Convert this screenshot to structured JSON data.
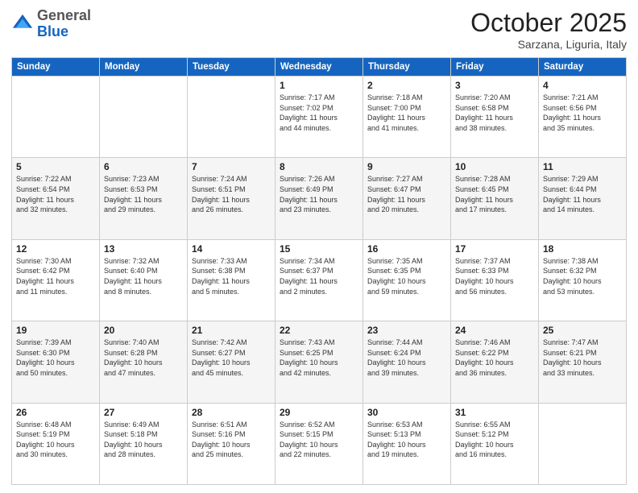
{
  "header": {
    "logo_general": "General",
    "logo_blue": "Blue",
    "month": "October 2025",
    "location": "Sarzana, Liguria, Italy"
  },
  "days_of_week": [
    "Sunday",
    "Monday",
    "Tuesday",
    "Wednesday",
    "Thursday",
    "Friday",
    "Saturday"
  ],
  "weeks": [
    [
      {
        "day": "",
        "info": ""
      },
      {
        "day": "",
        "info": ""
      },
      {
        "day": "",
        "info": ""
      },
      {
        "day": "1",
        "info": "Sunrise: 7:17 AM\nSunset: 7:02 PM\nDaylight: 11 hours\nand 44 minutes."
      },
      {
        "day": "2",
        "info": "Sunrise: 7:18 AM\nSunset: 7:00 PM\nDaylight: 11 hours\nand 41 minutes."
      },
      {
        "day": "3",
        "info": "Sunrise: 7:20 AM\nSunset: 6:58 PM\nDaylight: 11 hours\nand 38 minutes."
      },
      {
        "day": "4",
        "info": "Sunrise: 7:21 AM\nSunset: 6:56 PM\nDaylight: 11 hours\nand 35 minutes."
      }
    ],
    [
      {
        "day": "5",
        "info": "Sunrise: 7:22 AM\nSunset: 6:54 PM\nDaylight: 11 hours\nand 32 minutes."
      },
      {
        "day": "6",
        "info": "Sunrise: 7:23 AM\nSunset: 6:53 PM\nDaylight: 11 hours\nand 29 minutes."
      },
      {
        "day": "7",
        "info": "Sunrise: 7:24 AM\nSunset: 6:51 PM\nDaylight: 11 hours\nand 26 minutes."
      },
      {
        "day": "8",
        "info": "Sunrise: 7:26 AM\nSunset: 6:49 PM\nDaylight: 11 hours\nand 23 minutes."
      },
      {
        "day": "9",
        "info": "Sunrise: 7:27 AM\nSunset: 6:47 PM\nDaylight: 11 hours\nand 20 minutes."
      },
      {
        "day": "10",
        "info": "Sunrise: 7:28 AM\nSunset: 6:45 PM\nDaylight: 11 hours\nand 17 minutes."
      },
      {
        "day": "11",
        "info": "Sunrise: 7:29 AM\nSunset: 6:44 PM\nDaylight: 11 hours\nand 14 minutes."
      }
    ],
    [
      {
        "day": "12",
        "info": "Sunrise: 7:30 AM\nSunset: 6:42 PM\nDaylight: 11 hours\nand 11 minutes."
      },
      {
        "day": "13",
        "info": "Sunrise: 7:32 AM\nSunset: 6:40 PM\nDaylight: 11 hours\nand 8 minutes."
      },
      {
        "day": "14",
        "info": "Sunrise: 7:33 AM\nSunset: 6:38 PM\nDaylight: 11 hours\nand 5 minutes."
      },
      {
        "day": "15",
        "info": "Sunrise: 7:34 AM\nSunset: 6:37 PM\nDaylight: 11 hours\nand 2 minutes."
      },
      {
        "day": "16",
        "info": "Sunrise: 7:35 AM\nSunset: 6:35 PM\nDaylight: 10 hours\nand 59 minutes."
      },
      {
        "day": "17",
        "info": "Sunrise: 7:37 AM\nSunset: 6:33 PM\nDaylight: 10 hours\nand 56 minutes."
      },
      {
        "day": "18",
        "info": "Sunrise: 7:38 AM\nSunset: 6:32 PM\nDaylight: 10 hours\nand 53 minutes."
      }
    ],
    [
      {
        "day": "19",
        "info": "Sunrise: 7:39 AM\nSunset: 6:30 PM\nDaylight: 10 hours\nand 50 minutes."
      },
      {
        "day": "20",
        "info": "Sunrise: 7:40 AM\nSunset: 6:28 PM\nDaylight: 10 hours\nand 47 minutes."
      },
      {
        "day": "21",
        "info": "Sunrise: 7:42 AM\nSunset: 6:27 PM\nDaylight: 10 hours\nand 45 minutes."
      },
      {
        "day": "22",
        "info": "Sunrise: 7:43 AM\nSunset: 6:25 PM\nDaylight: 10 hours\nand 42 minutes."
      },
      {
        "day": "23",
        "info": "Sunrise: 7:44 AM\nSunset: 6:24 PM\nDaylight: 10 hours\nand 39 minutes."
      },
      {
        "day": "24",
        "info": "Sunrise: 7:46 AM\nSunset: 6:22 PM\nDaylight: 10 hours\nand 36 minutes."
      },
      {
        "day": "25",
        "info": "Sunrise: 7:47 AM\nSunset: 6:21 PM\nDaylight: 10 hours\nand 33 minutes."
      }
    ],
    [
      {
        "day": "26",
        "info": "Sunrise: 6:48 AM\nSunset: 5:19 PM\nDaylight: 10 hours\nand 30 minutes."
      },
      {
        "day": "27",
        "info": "Sunrise: 6:49 AM\nSunset: 5:18 PM\nDaylight: 10 hours\nand 28 minutes."
      },
      {
        "day": "28",
        "info": "Sunrise: 6:51 AM\nSunset: 5:16 PM\nDaylight: 10 hours\nand 25 minutes."
      },
      {
        "day": "29",
        "info": "Sunrise: 6:52 AM\nSunset: 5:15 PM\nDaylight: 10 hours\nand 22 minutes."
      },
      {
        "day": "30",
        "info": "Sunrise: 6:53 AM\nSunset: 5:13 PM\nDaylight: 10 hours\nand 19 minutes."
      },
      {
        "day": "31",
        "info": "Sunrise: 6:55 AM\nSunset: 5:12 PM\nDaylight: 10 hours\nand 16 minutes."
      },
      {
        "day": "",
        "info": ""
      }
    ]
  ]
}
